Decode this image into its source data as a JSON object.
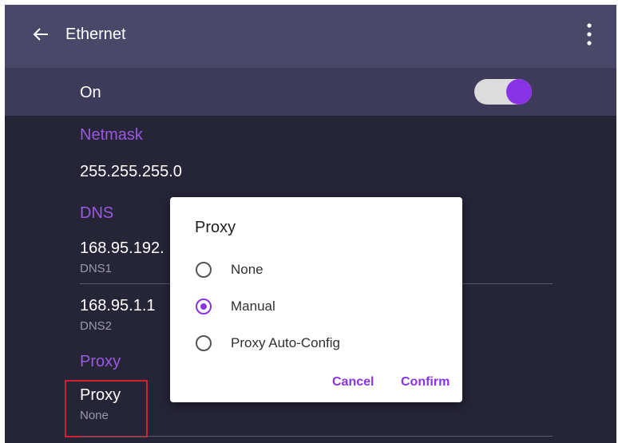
{
  "appbar": {
    "title": "Ethernet",
    "back_icon": "arrow-left-icon",
    "menu_icon": "more-vertical-icon"
  },
  "ethernet_toggle": {
    "label": "On",
    "state": "on",
    "accent": "#8a32e6"
  },
  "settings": {
    "netmask": {
      "header": "Netmask",
      "value": "255.255.255.0"
    },
    "dns": {
      "header": "DNS",
      "dns1": {
        "value": "168.95.192.",
        "label": "DNS1"
      },
      "dns2": {
        "value": "168.95.1.1",
        "label": "DNS2"
      }
    },
    "proxy": {
      "header": "Proxy",
      "title": "Proxy",
      "value": "None"
    }
  },
  "dialog": {
    "title": "Proxy",
    "options": [
      {
        "label": "None",
        "selected": false
      },
      {
        "label": "Manual",
        "selected": true
      },
      {
        "label": "Proxy Auto-Config",
        "selected": false
      }
    ],
    "cancel_label": "Cancel",
    "confirm_label": "Confirm"
  },
  "colors": {
    "background": "#262538",
    "appbar": "#4a4869",
    "toggle_bar": "#3d3b59",
    "section_header": "#9b59e0",
    "accent": "#8a32e6",
    "highlight_box": "#d0202a"
  }
}
